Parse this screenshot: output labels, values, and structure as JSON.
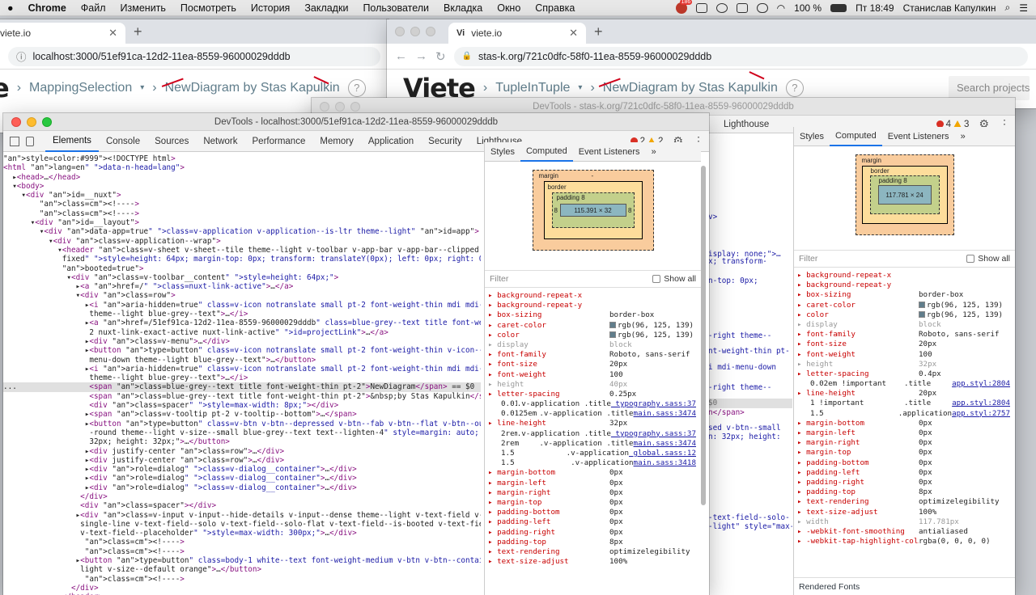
{
  "menubar": {
    "items": [
      "Chrome",
      "Файл",
      "Изменить",
      "Посмотреть",
      "История",
      "Закладки",
      "Пользователи",
      "Вкладка",
      "Окно",
      "Справка"
    ],
    "notif_count": "186",
    "battery": "100 %",
    "clock": "Пт 18:49",
    "user": "Станислав Капулкин"
  },
  "left_browser": {
    "tab_title": "viete.io",
    "url": "localhost:3000/51ef91ca-12d2-11ea-8559-96000029dddb",
    "breadcrumb_project": "MappingSelection",
    "breadcrumb_diagram": "NewDiagram by Stas Kapulkin",
    "help": "?"
  },
  "right_browser": {
    "tab_title": "viete.io",
    "url": "stas-k.org/721c0dfc-58f0-11ea-8559-96000029dddb",
    "logo": "Viete",
    "breadcrumb_project": "TupleInTuple",
    "breadcrumb_diagram": "NewDiagram by Stas Kapulkin",
    "help": "?",
    "search_placeholder": "Search projects"
  },
  "left_devtools": {
    "title": "DevTools - localhost:3000/51ef91ca-12d2-11ea-8559-96000029dddb",
    "tabs": [
      "Elements",
      "Console",
      "Sources",
      "Network",
      "Performance",
      "Memory",
      "Application",
      "Security",
      "Lighthouse"
    ],
    "errors": "2",
    "warnings": "2",
    "style_tabs": [
      "Styles",
      "Computed",
      "Event Listeners",
      "»"
    ],
    "box_model": {
      "margin_label": "margin",
      "border_label": "border",
      "padding_label": "padding 8",
      "content": "115.391 × 32",
      "dash": "-",
      "side_8": "8"
    },
    "filter_placeholder": "Filter",
    "show_all": "Show all",
    "computed": [
      {
        "name": "background-repeat-x",
        "value": ""
      },
      {
        "name": "background-repeat-y",
        "value": ""
      },
      {
        "name": "box-sizing",
        "value": "border-box"
      },
      {
        "name": "caret-color",
        "value": "rgb(96, 125, 139)"
      },
      {
        "name": "color",
        "value": "rgb(96, 125, 139)"
      },
      {
        "name": "display",
        "value": "block"
      },
      {
        "name": "font-family",
        "value": "Roboto, sans-serif"
      },
      {
        "name": "font-size",
        "value": "20px"
      },
      {
        "name": "font-weight",
        "value": "100"
      },
      {
        "name": "height",
        "value": "40px"
      },
      {
        "name": "letter-spacing",
        "value": "0.25px"
      },
      {
        "name": "0.0125em !important",
        "value": ".v-application .title",
        "src": "_typography.sass:37"
      },
      {
        "name": "0.0125em !important",
        "value": ".v-application .title",
        "src": "main.sass:3474"
      },
      {
        "name": "line-height",
        "value": "32px"
      },
      {
        "name": "2rem",
        "value": ".v-application .title",
        "src": "_typography.sass:37"
      },
      {
        "name": "2rem",
        "value": ".v-application .title",
        "src": "main.sass:3474"
      },
      {
        "name": "1.5",
        "value": ".v-application",
        "src": "_global.sass:12"
      },
      {
        "name": "1.5",
        "value": ".v-application",
        "src": "main.sass:3418"
      },
      {
        "name": "margin-bottom",
        "value": "0px"
      },
      {
        "name": "margin-left",
        "value": "0px"
      },
      {
        "name": "margin-right",
        "value": "0px"
      },
      {
        "name": "margin-top",
        "value": "0px"
      },
      {
        "name": "padding-bottom",
        "value": "0px"
      },
      {
        "name": "padding-left",
        "value": "0px"
      },
      {
        "name": "padding-right",
        "value": "0px"
      },
      {
        "name": "padding-top",
        "value": "8px"
      },
      {
        "name": "text-rendering",
        "value": "optimizelegibility"
      },
      {
        "name": "text-size-adjust",
        "value": "100%"
      }
    ]
  },
  "right_devtools": {
    "title": "DevTools - stas-k.org/721c0dfc-58f0-11ea-8559-96000029dddb",
    "tab_visible": "Lighthouse",
    "errors": "4",
    "warnings": "3",
    "style_tabs": [
      "Styles",
      "Computed",
      "Event Listeners",
      "»"
    ],
    "box_model": {
      "margin_label": "margin",
      "border_label": "border",
      "padding_label": "padding 8",
      "content": "117.781 × 24",
      "dash": "-"
    },
    "filter_placeholder": "Filter",
    "show_all": "Show all",
    "rendered_fonts": "Rendered Fonts",
    "computed": [
      {
        "name": "background-repeat-x",
        "value": ""
      },
      {
        "name": "background-repeat-y",
        "value": ""
      },
      {
        "name": "box-sizing",
        "value": "border-box"
      },
      {
        "name": "caret-color",
        "value": "rgb(96, 125, 139)"
      },
      {
        "name": "color",
        "value": "rgb(96, 125, 139)"
      },
      {
        "name": "display",
        "value": "block"
      },
      {
        "name": "font-family",
        "value": "Roboto, sans-serif"
      },
      {
        "name": "font-size",
        "value": "20px"
      },
      {
        "name": "font-weight",
        "value": "100"
      },
      {
        "name": "height",
        "value": "32px"
      },
      {
        "name": "letter-spacing",
        "value": "0.4px"
      },
      {
        "name": "0.02em !important",
        "value": ".title",
        "src": "app.styl:2804"
      },
      {
        "name": "line-height",
        "value": "20px"
      },
      {
        "name": "1 !important",
        "value": ".title",
        "src": "app.styl:2804"
      },
      {
        "name": "1.5",
        "value": ".application",
        "src": "app.styl:2757"
      },
      {
        "name": "margin-bottom",
        "value": "0px"
      },
      {
        "name": "margin-left",
        "value": "0px"
      },
      {
        "name": "margin-right",
        "value": "0px"
      },
      {
        "name": "margin-top",
        "value": "0px"
      },
      {
        "name": "padding-bottom",
        "value": "0px"
      },
      {
        "name": "padding-left",
        "value": "0px"
      },
      {
        "name": "padding-right",
        "value": "0px"
      },
      {
        "name": "padding-top",
        "value": "8px"
      },
      {
        "name": "text-rendering",
        "value": "optimizelegibility"
      },
      {
        "name": "text-size-adjust",
        "value": "100%"
      },
      {
        "name": "width",
        "value": "117.781px"
      },
      {
        "name": "-webkit-font-smoothing",
        "value": "antialiased"
      },
      {
        "name": "-webkit-tap-highlight-col…",
        "value": "rgba(0, 0, 0, 0)"
      }
    ],
    "peek_lines": [
      "v>",
      "x; transform-",
      "n-top: 0px;",
      "isplay: none;\">…",
      "-right theme--",
      "nt-weight-thin pt-",
      "i mdi-menu-down",
      "-right theme--",
      "$0",
      "n</span>",
      "sed v-btn--small",
      "n: 32px; height:",
      "-text-field--solo-",
      "-light\" style=\"max-"
    ]
  },
  "dom_lines": [
    "<!DOCTYPE html>",
    "<html lang=\"en\" data-n-head=\"lang\">",
    "  ▸<head>…</head>",
    "  ▾<body>",
    "    ▾<div id=\"__nuxt\">",
    "        <!---->",
    "        <!---->",
    "      ▾<div id=\"__layout\">",
    "        ▾<div data-app=\"true\" class=\"v-application v-application--is-ltr theme--light\" id=\"app\">",
    "          ▾<div class=\"v-application--wrap\">",
    "            ▾<header class=\"v-sheet v-sheet--tile theme--light v-toolbar v-app-bar v-app-bar--clipped v-app-bar--",
    "             fixed\" style=\"height: 64px; margin-top: 0px; transform: translateY(0px); left: 0px; right: 0px;\" data-",
    "             booted=\"true\">",
    "              ▾<div class=\"v-toolbar__content\" style=\"height: 64px;\">",
    "                ▸<a href=\"/\" class=\"nuxt-link-active\">…</a>",
    "                ▾<div class=\"row\">",
    "                  ▸<i aria-hidden=\"true\" class=\"v-icon notranslate small pt-2 font-weight-thin mdi mdi-chevron-right",
    "                   theme--light blue-grey--text\">…</i>",
    "                  ▸<a href=\"/51ef91ca-12d2-11ea-8559-96000029dddb\" class=\"blue-grey--text title font-weight-thin pt-",
    "                   2 nuxt-link-exact-active nuxt-link-active\" id=\"projectLink\">…</a>",
    "                  ▸<div class=\"v-menu\">…</div>",
    "                  ▸<button type=\"button\" class=\"v-icon notranslate small pt-2 font-weight-thin v-icon--link mdi mdi-",
    "                   menu-down theme--light blue-grey--text\">…</button>",
    "                  ▸<i aria-hidden=\"true\" class=\"v-icon notranslate small pt-2 font-weight-thin mdi mdi-chevron-right",
    "                   theme--light blue-grey--text\">…</i>",
    "...                <span class=\"blue-grey--text title font-weight-thin pt-2\">NewDiagram</span> == $0",
    "                   <span class=\"blue-grey--text title font-weight-thin pt-2\">&nbsp;by Stas Kapulkin</span>",
    "                   <div class=\"spacer\" style=\"max-width: 8px;\"></div>",
    "                  ▸<span class=\"v-tooltip pt-2 v-tooltip--bottom\">…</span>",
    "                  ▸<button type=\"button\" class=\"v-btn v-btn--depressed v-btn--fab v-btn--flat v-btn--outlined v-btn-",
    "                   -round theme--light v-size--small blue-grey--text text--lighten-4\" style=\"margin: auto; width:",
    "                   32px; height: 32px;\">…</button>",
    "                  ▸<div justify-center class=\"row\">…</div>",
    "                  ▸<div justify-center class=\"row\">…</div>",
    "                  ▸<div role=\"dialog\" class=\"v-dialog__container\">…</div>",
    "                  ▸<div role=\"dialog\" class=\"v-dialog__container\">…</div>",
    "                  ▸<div role=\"dialog\" class=\"v-dialog__container\">…</div>",
    "                 </div>",
    "                 <div class=\"spacer\"></div>",
    "                ▸<div class=\"v-input v-input--hide-details v-input--dense theme--light v-text-field v-text-field--",
    "                 single-line v-text-field--solo v-text-field--solo-flat v-text-field--is-booted v-text-field--enclosed",
    "                 v-text-field--placeholder\" style=\"max-width: 300px;\">…</div>",
    "                  <!---->",
    "                  <!---->",
    "                ▸<button type=\"button\" class=\"body-1 white--text font-weight-medium v-btn v-btn--contained theme--",
    "                 light v-size--default orange\">…</button>",
    "                  <!---->",
    "               </div>",
    "             </header>"
  ]
}
